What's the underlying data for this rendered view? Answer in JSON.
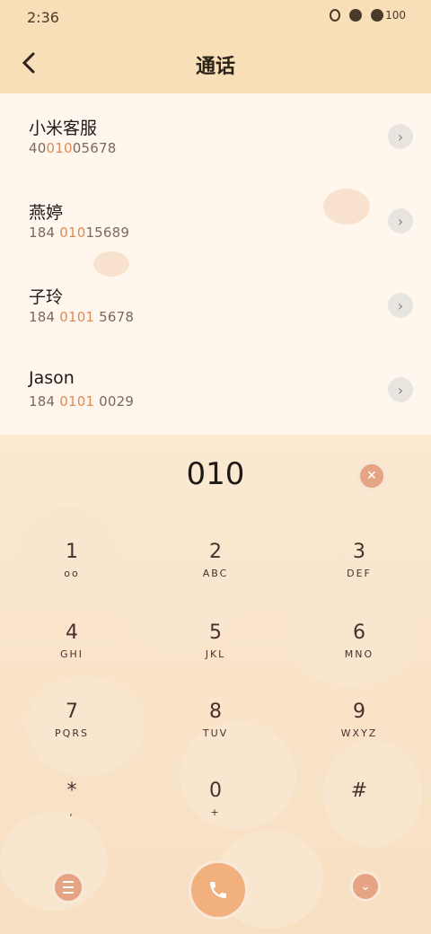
{
  "status": {
    "time": "2:36",
    "battery": "100"
  },
  "header": {
    "title": "通话"
  },
  "contacts": [
    {
      "name": "小米客服",
      "num_pre": "40",
      "num_hl": "010",
      "num_post": "05678"
    },
    {
      "name": "燕婷",
      "num_pre": "184 ",
      "num_hl": "010",
      "num_post": "15689"
    },
    {
      "name": "子玲",
      "num_pre": "184 ",
      "num_hl": "0101",
      "num_post": " 5678"
    },
    {
      "name": "Jason",
      "num_pre": "184 ",
      "num_hl": "0101",
      "num_post": " 0029"
    }
  ],
  "dialer": {
    "input": "010",
    "keys": [
      {
        "digit": "1",
        "letters": "oo"
      },
      {
        "digit": "2",
        "letters": "ABC"
      },
      {
        "digit": "3",
        "letters": "DEF"
      },
      {
        "digit": "4",
        "letters": "GHI"
      },
      {
        "digit": "5",
        "letters": "JKL"
      },
      {
        "digit": "6",
        "letters": "MNO"
      },
      {
        "digit": "7",
        "letters": "PQRS"
      },
      {
        "digit": "8",
        "letters": "TUV"
      },
      {
        "digit": "9",
        "letters": "WXYZ"
      },
      {
        "digit": "*",
        "letters": ","
      },
      {
        "digit": "0",
        "letters": "+"
      },
      {
        "digit": "#",
        "letters": ""
      }
    ]
  },
  "colors": {
    "accent": "#e08a55",
    "header_bg": "#f9dfb7",
    "call_button": "#f3b07f"
  }
}
